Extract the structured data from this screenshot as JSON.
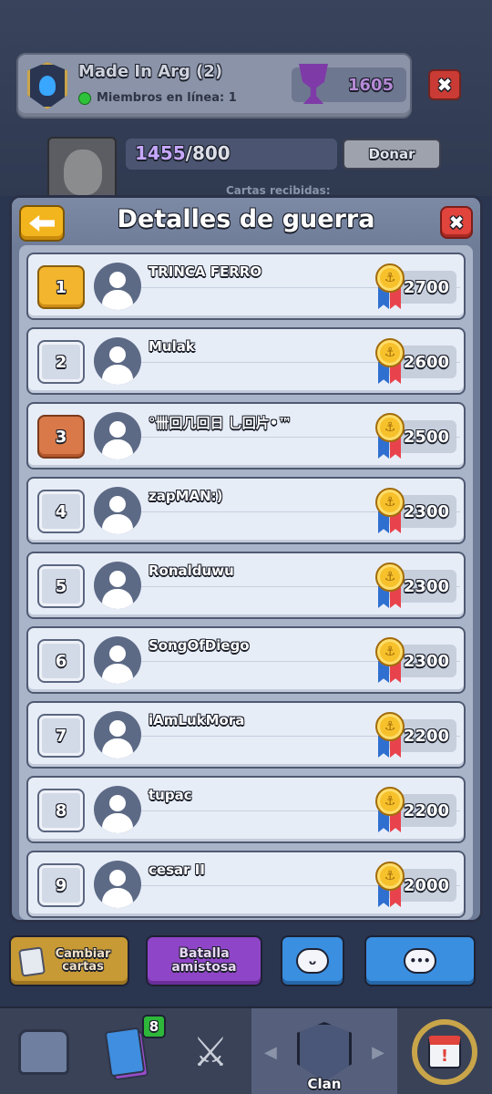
{
  "clan": {
    "name": "Made In Arg (2)",
    "online_label": "Miembros en línea: 1",
    "trophies": "1605"
  },
  "donation": {
    "current": "1455",
    "total": "/800",
    "donate_label": "Donar",
    "received_label": "Cartas recibidas:"
  },
  "modal": {
    "title": "Detalles de guerra",
    "close_symbol": "✖",
    "rows": [
      {
        "rank": "1",
        "name": "TRINCA FERRO",
        "score": "2700"
      },
      {
        "rank": "2",
        "name": "Mulak",
        "score": "2600"
      },
      {
        "rank": "3",
        "name": "°卌回几回日 乚回片•™",
        "score": "2500"
      },
      {
        "rank": "4",
        "name": "zapMAN:)",
        "score": "2300"
      },
      {
        "rank": "5",
        "name": "Ronalduwu",
        "score": "2300"
      },
      {
        "rank": "6",
        "name": "SongOfDiego",
        "score": "2300"
      },
      {
        "rank": "7",
        "name": "iAmLukMora",
        "score": "2200"
      },
      {
        "rank": "8",
        "name": "tupac",
        "score": "2200"
      },
      {
        "rank": "9",
        "name": "cesar II",
        "score": "2000"
      }
    ]
  },
  "actions": {
    "swap_label": "Cambiar cartas",
    "battle_label": "Batalla amistosa"
  },
  "nav": {
    "cards_badge": "8",
    "clan_label": "Clan"
  },
  "colors": {
    "gold_rank": "#f2b52d",
    "bronze_rank": "#d9794a",
    "close_red": "#e0443c",
    "back_yellow": "#f3b51d"
  }
}
